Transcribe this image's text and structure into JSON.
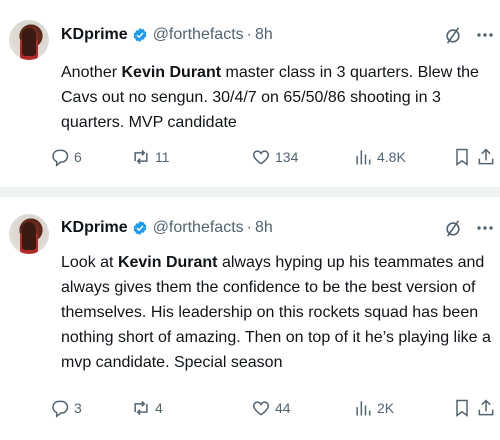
{
  "tweets": [
    {
      "author": "KDprime",
      "handle": "@forthefacts",
      "time": "8h",
      "text_before": "Another ",
      "text_bold": "Kevin Durant",
      "text_after": " master class in 3 quarters. Blew the Cavs out no sengun. 30/4/7 on 65/50/86 shooting in 3 quarters. MVP candidate",
      "replies": "6",
      "reposts": "11",
      "likes": "134",
      "views": "4.8K"
    },
    {
      "author": "KDprime",
      "handle": "@forthefacts",
      "time": "8h",
      "text_before": "Look at ",
      "text_bold": "Kevin Durant",
      "text_after": " always hyping up his teammates and always gives them the confidence to be the best version of themselves. His leadership on this rockets squad has been nothing short of amazing. Then on top of it he’s playing like a mvp candidate. Special season",
      "replies": "3",
      "reposts": "4",
      "likes": "44",
      "views": "2K"
    }
  ],
  "icons": {
    "verified": "verified-badge-icon",
    "grok": "grok-icon",
    "more": "more-options-icon",
    "reply": "reply-icon",
    "repost": "repost-icon",
    "like": "like-icon",
    "views": "views-icon",
    "bookmark": "bookmark-icon",
    "share": "share-icon"
  },
  "colors": {
    "verified": "#1d9bf0",
    "muted": "#536471",
    "text": "#0f1419",
    "divider": "#eff3f4"
  }
}
